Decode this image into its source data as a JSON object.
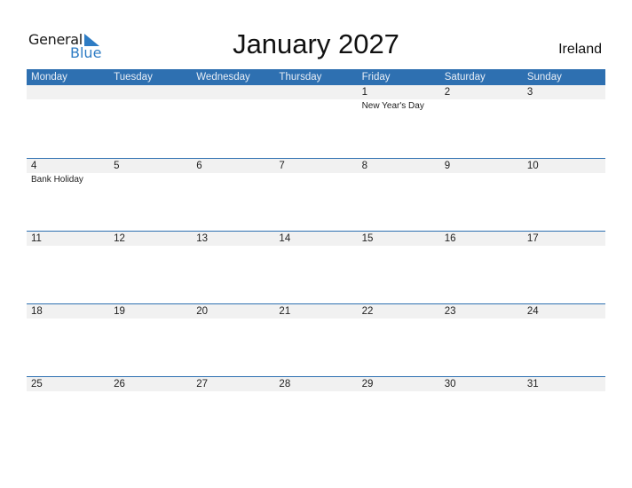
{
  "logo": {
    "word1": "General",
    "word2": "Blue",
    "accent": "#2e7cc4"
  },
  "title": "January 2027",
  "country": "Ireland",
  "weekdays": [
    "Monday",
    "Tuesday",
    "Wednesday",
    "Thursday",
    "Friday",
    "Saturday",
    "Sunday"
  ],
  "weeks": [
    [
      {
        "day": ""
      },
      {
        "day": ""
      },
      {
        "day": ""
      },
      {
        "day": ""
      },
      {
        "day": "1",
        "holiday": "New Year's Day"
      },
      {
        "day": "2"
      },
      {
        "day": "3"
      }
    ],
    [
      {
        "day": "4",
        "holiday": "Bank Holiday"
      },
      {
        "day": "5"
      },
      {
        "day": "6"
      },
      {
        "day": "7"
      },
      {
        "day": "8"
      },
      {
        "day": "9"
      },
      {
        "day": "10"
      }
    ],
    [
      {
        "day": "11"
      },
      {
        "day": "12"
      },
      {
        "day": "13"
      },
      {
        "day": "14"
      },
      {
        "day": "15"
      },
      {
        "day": "16"
      },
      {
        "day": "17"
      }
    ],
    [
      {
        "day": "18"
      },
      {
        "day": "19"
      },
      {
        "day": "20"
      },
      {
        "day": "21"
      },
      {
        "day": "22"
      },
      {
        "day": "23"
      },
      {
        "day": "24"
      }
    ],
    [
      {
        "day": "25"
      },
      {
        "day": "26"
      },
      {
        "day": "27"
      },
      {
        "day": "28"
      },
      {
        "day": "29"
      },
      {
        "day": "30"
      },
      {
        "day": "31"
      }
    ]
  ],
  "colors": {
    "header_bg": "#2e70b1",
    "day_bar_bg": "#f1f1f1"
  }
}
